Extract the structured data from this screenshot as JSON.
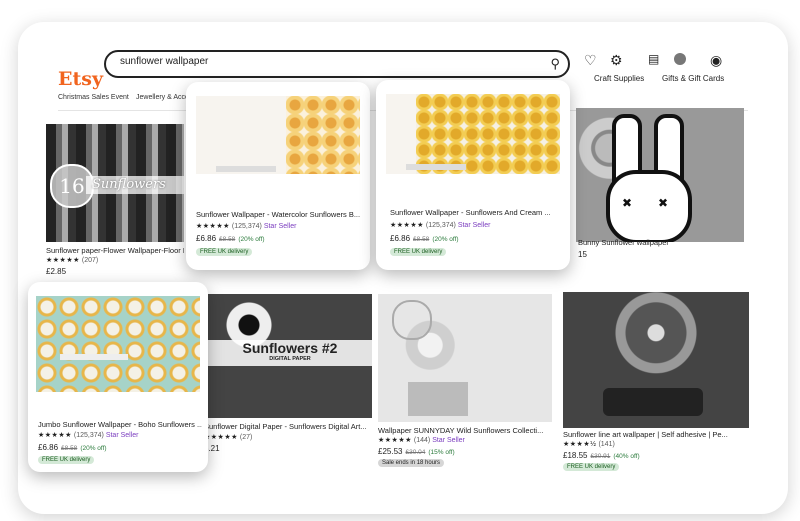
{
  "header": {
    "logo": "Etsy",
    "search_value": "sunflower wallpaper",
    "nav_right": [
      "Craft Supplies",
      "Gifts & Gift Cards"
    ],
    "categories": [
      "Christmas Sales Event",
      "Jewellery & Acce"
    ]
  },
  "icons": {
    "search": "search-icon",
    "heart": "heart-icon",
    "bell": "bell-icon",
    "gift": "gift-icon",
    "cart": "cart-icon"
  },
  "colors": {
    "accent": "#f1641e",
    "star_seller": "#7a3cbf",
    "discount": "#2a7a3b"
  },
  "products": [
    {
      "title": "Sunflower paper-Flower Wallpaper-Floor Pap",
      "stars": "★★★★★",
      "reviews": "(207)",
      "price": "£2.85",
      "overlay_number": "16",
      "overlay_text": "Sunflowers"
    },
    {
      "title": "Bunny Sunflower wallpaper",
      "price": "15"
    },
    {
      "title": "Sunflower Digital Paper - Sunflowers Digital Art...",
      "stars": "★★★★★",
      "reviews": "(27)",
      "price": "3.21",
      "overlay_text": "Sunflowers #2",
      "overlay_sub": "DIGITAL PAPER"
    },
    {
      "title": "Wallpaper SUNNYDAY Wild Sunflowers Collecti...",
      "stars": "★★★★★",
      "reviews": "(144)",
      "star_seller": "Star Seller",
      "price": "£25.53",
      "orig": "£30.04",
      "disc": "(15% off)",
      "badge": "Sale ends in 18 hours"
    },
    {
      "title": "Sunflower line art wallpaper | Self adhesive | Pe...",
      "stars": "★★★★½",
      "reviews": "(141)",
      "price": "£18.55",
      "orig": "£30.91",
      "disc": "(40% off)",
      "badge": "FREE UK delivery"
    }
  ],
  "popups": [
    {
      "title": "Sunflower Wallpaper - Watercolor Sunflowers B...",
      "stars": "★★★★★",
      "reviews": "(125,374)",
      "star_seller": "Star Seller",
      "price": "£6.86",
      "orig": "£8.58",
      "disc": "(20% off)",
      "badge": "FREE UK delivery"
    },
    {
      "title": "Sunflower Wallpaper - Sunflowers And Cream ...",
      "stars": "★★★★★",
      "reviews": "(125,374)",
      "star_seller": "Star Seller",
      "price": "£6.86",
      "orig": "£8.58",
      "disc": "(20% off)",
      "badge": "FREE UK delivery"
    },
    {
      "title": "Jumbo Sunflower Wallpaper - Boho Sunflowers ...",
      "stars": "★★★★★",
      "reviews": "(125,374)",
      "star_seller": "Star Seller",
      "price": "£6.86",
      "orig": "£8.58",
      "disc": "(20% off)",
      "badge": "FREE UK delivery"
    }
  ]
}
